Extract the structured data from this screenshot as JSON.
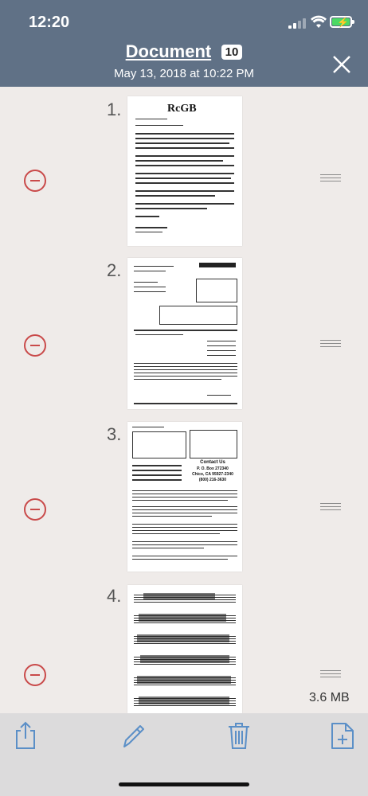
{
  "status_bar": {
    "time": "12:20"
  },
  "header": {
    "title": "Document",
    "page_count": "10",
    "date": "May 13, 2018 at 10:22 PM"
  },
  "pages": [
    {
      "number": "1.",
      "logo_text": "RcGB"
    },
    {
      "number": "2."
    },
    {
      "number": "3.",
      "contact_title": "Contact Us",
      "contact_address": "P. O. Box 272340",
      "contact_city": "Chico, CA 95927-2340",
      "contact_phone": "(800) 216-3630"
    },
    {
      "number": "4."
    }
  ],
  "file_size": "3.6 MB",
  "toolbar": {
    "icons": [
      "share-icon",
      "edit-icon",
      "trash-icon",
      "add-page-icon"
    ]
  },
  "colors": {
    "header_bg": "#607186",
    "list_bg": "#efebe9",
    "remove_red": "#c94a4a",
    "toolbar_icon_blue": "#5b8fc7",
    "battery_green": "#4cd964"
  }
}
